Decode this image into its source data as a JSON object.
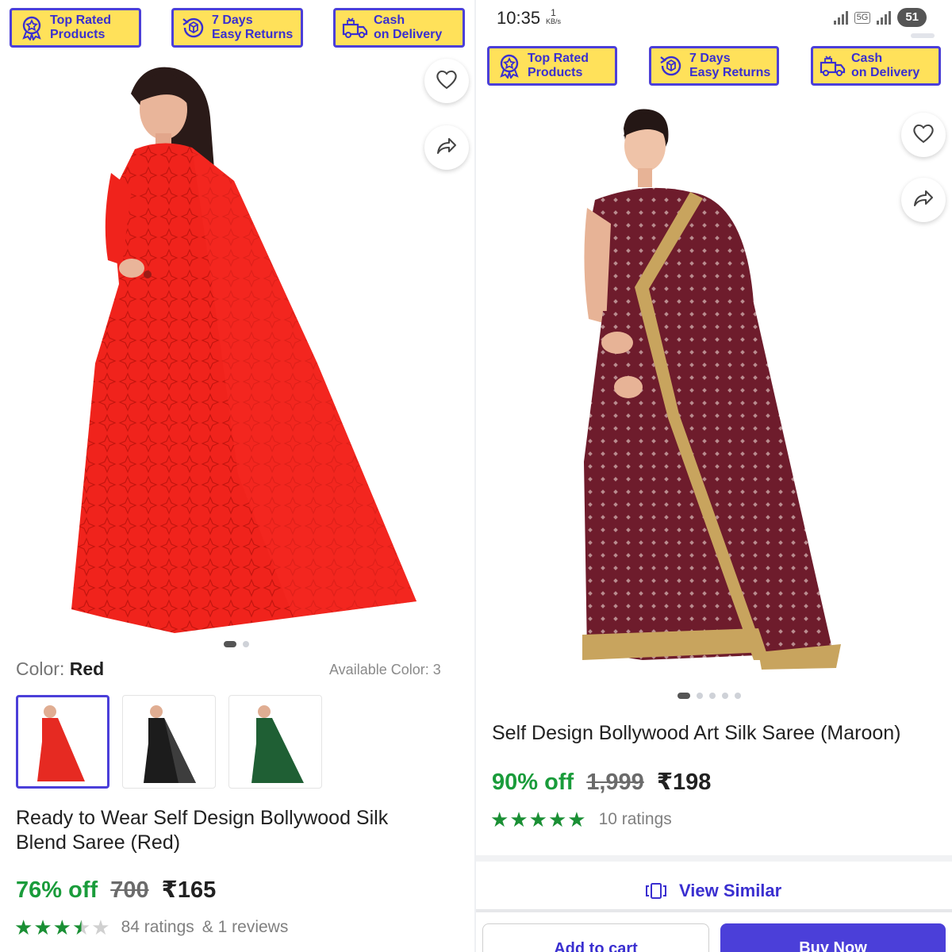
{
  "colors": {
    "accent": "#4b3fd9",
    "badge_bg": "#ffe15a",
    "discount": "#1a9c3b",
    "rating": "#1a8f34"
  },
  "left_panel": {
    "badges": [
      {
        "icon": "medal-icon",
        "line1": "Top Rated",
        "line2": "Products"
      },
      {
        "icon": "return-box-icon",
        "line1": "7 Days",
        "line2": "Easy Returns"
      },
      {
        "icon": "delivery-truck-icon",
        "line1": "Cash",
        "line2": "on Delivery"
      }
    ],
    "product": {
      "color_label": "Color:",
      "color_value": "Red",
      "available_colors": "Available Color: 3",
      "title_line1": "Ready to Wear Self Design Bollywood Silk",
      "title_line2": "Blend Saree (Red)",
      "discount": "76% off",
      "mrp": "700",
      "price": "₹165",
      "rating_stars": 3.5,
      "ratings_text": "84 ratings",
      "reviews_text": "& 1 reviews",
      "image_count": 2,
      "active_image": 0,
      "swatch_colors": [
        "#e62a22",
        "#1c1c1c",
        "#1f5f34"
      ]
    }
  },
  "right_panel": {
    "status_bar": {
      "time": "10:35",
      "speed_value": "1",
      "speed_unit": "KB/s",
      "network": "5G",
      "battery": "51"
    },
    "badges": [
      {
        "icon": "medal-icon",
        "line1": "Top Rated",
        "line2": "Products"
      },
      {
        "icon": "return-box-icon",
        "line1": "7 Days",
        "line2": "Easy Returns"
      },
      {
        "icon": "delivery-truck-icon",
        "line1": "Cash",
        "line2": "on Delivery"
      }
    ],
    "product": {
      "title": "Self Design Bollywood Art Silk Saree (Maroon)",
      "discount": "90% off",
      "mrp": "1,999",
      "price": "₹198",
      "rating_stars": 5,
      "ratings_text": "10 ratings",
      "image_count": 5,
      "active_image": 0
    },
    "view_similar": "View Similar",
    "add_to_cart": "Add to cart",
    "buy_now": "Buy Now"
  }
}
